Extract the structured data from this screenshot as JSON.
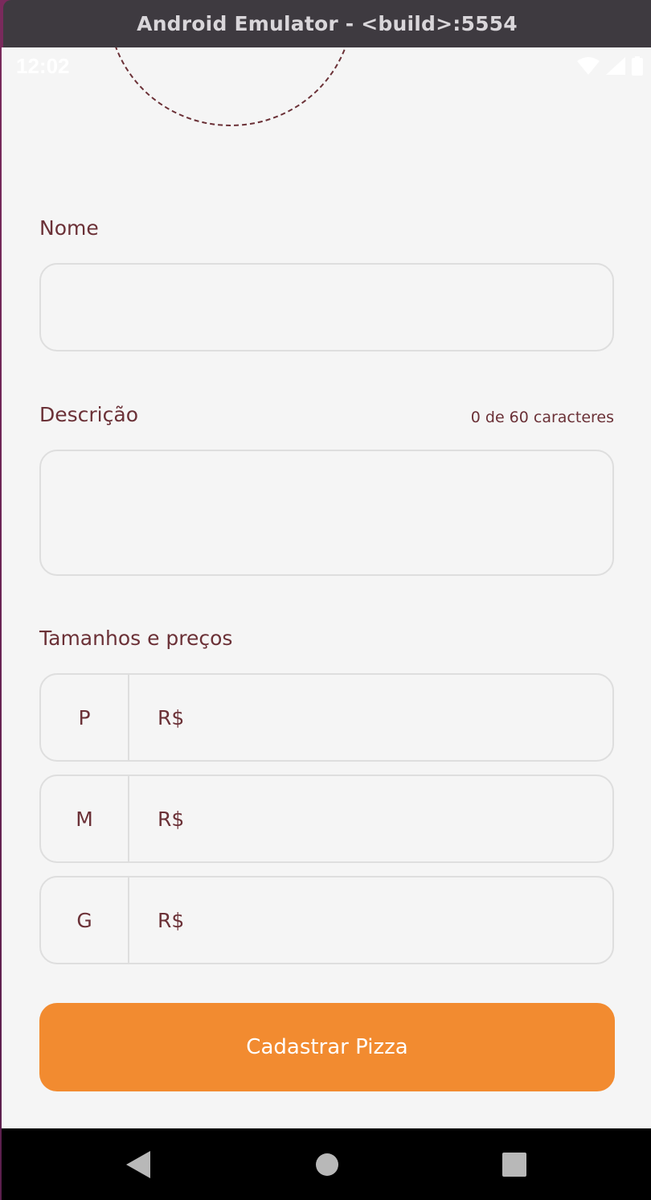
{
  "window": {
    "title": "Android Emulator - <build>:5554"
  },
  "status_bar": {
    "time": "12:02",
    "icons": [
      "wifi-icon",
      "signal-icon",
      "battery-icon"
    ]
  },
  "form": {
    "nome_label": "Nome",
    "nome_value": "",
    "descricao_label": "Descrição",
    "descricao_value": "",
    "descricao_counter": "0 de 60 caracteres",
    "sizes_label": "Tamanhos e preços",
    "sizes": [
      {
        "size": "P",
        "currency": "R$"
      },
      {
        "size": "M",
        "currency": "R$"
      },
      {
        "size": "G",
        "currency": "R$"
      }
    ],
    "submit_label": "Cadastrar Pizza"
  },
  "nav_bar": {
    "buttons": [
      "back-icon",
      "home-icon",
      "recents-icon"
    ]
  },
  "colors": {
    "accent": "#f28b30",
    "text": "#6b3137",
    "background": "#f5f5f5",
    "border": "#dedede"
  }
}
